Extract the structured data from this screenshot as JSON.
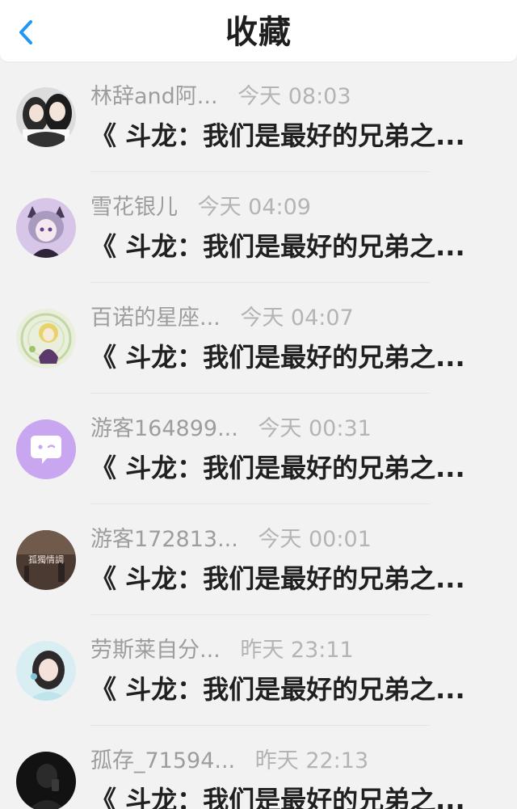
{
  "header": {
    "title": "收藏",
    "back_icon": "chevron-left-icon",
    "accent": "#2196f3"
  },
  "items": [
    {
      "name": "林辞and阿...",
      "time": "今天 08:03",
      "title": "《 斗龙：我们是最好的兄弟之...",
      "avatar": "avatar-two-girls"
    },
    {
      "name": "雪花银儿",
      "time": "今天 04:09",
      "title": "《 斗龙：我们是最好的兄弟之...",
      "avatar": "avatar-cat-ear-girl"
    },
    {
      "name": "百诺的星座...",
      "time": "今天 04:07",
      "title": "《 斗龙：我们是最好的兄弟之...",
      "avatar": "avatar-anime-girl-green"
    },
    {
      "name": "游客164899...",
      "time": "今天 00:31",
      "title": "《 斗龙：我们是最好的兄弟之...",
      "avatar": "avatar-chat-bubble-default"
    },
    {
      "name": "游客172813...",
      "time": "今天 00:01",
      "title": "《 斗龙：我们是最好的兄弟之...",
      "avatar": "avatar-text-孤獨情調"
    },
    {
      "name": "劳斯莱自分...",
      "time": "昨天 23:11",
      "title": "《 斗龙：我们是最好的兄弟之...",
      "avatar": "avatar-girl-portrait"
    },
    {
      "name": "孤存_71594...",
      "time": "昨天 22:13",
      "title": "《 斗龙：我们是最好的兄弟之...",
      "avatar": "avatar-dark-silhouette"
    }
  ],
  "avatar_text": "孤獨情調"
}
